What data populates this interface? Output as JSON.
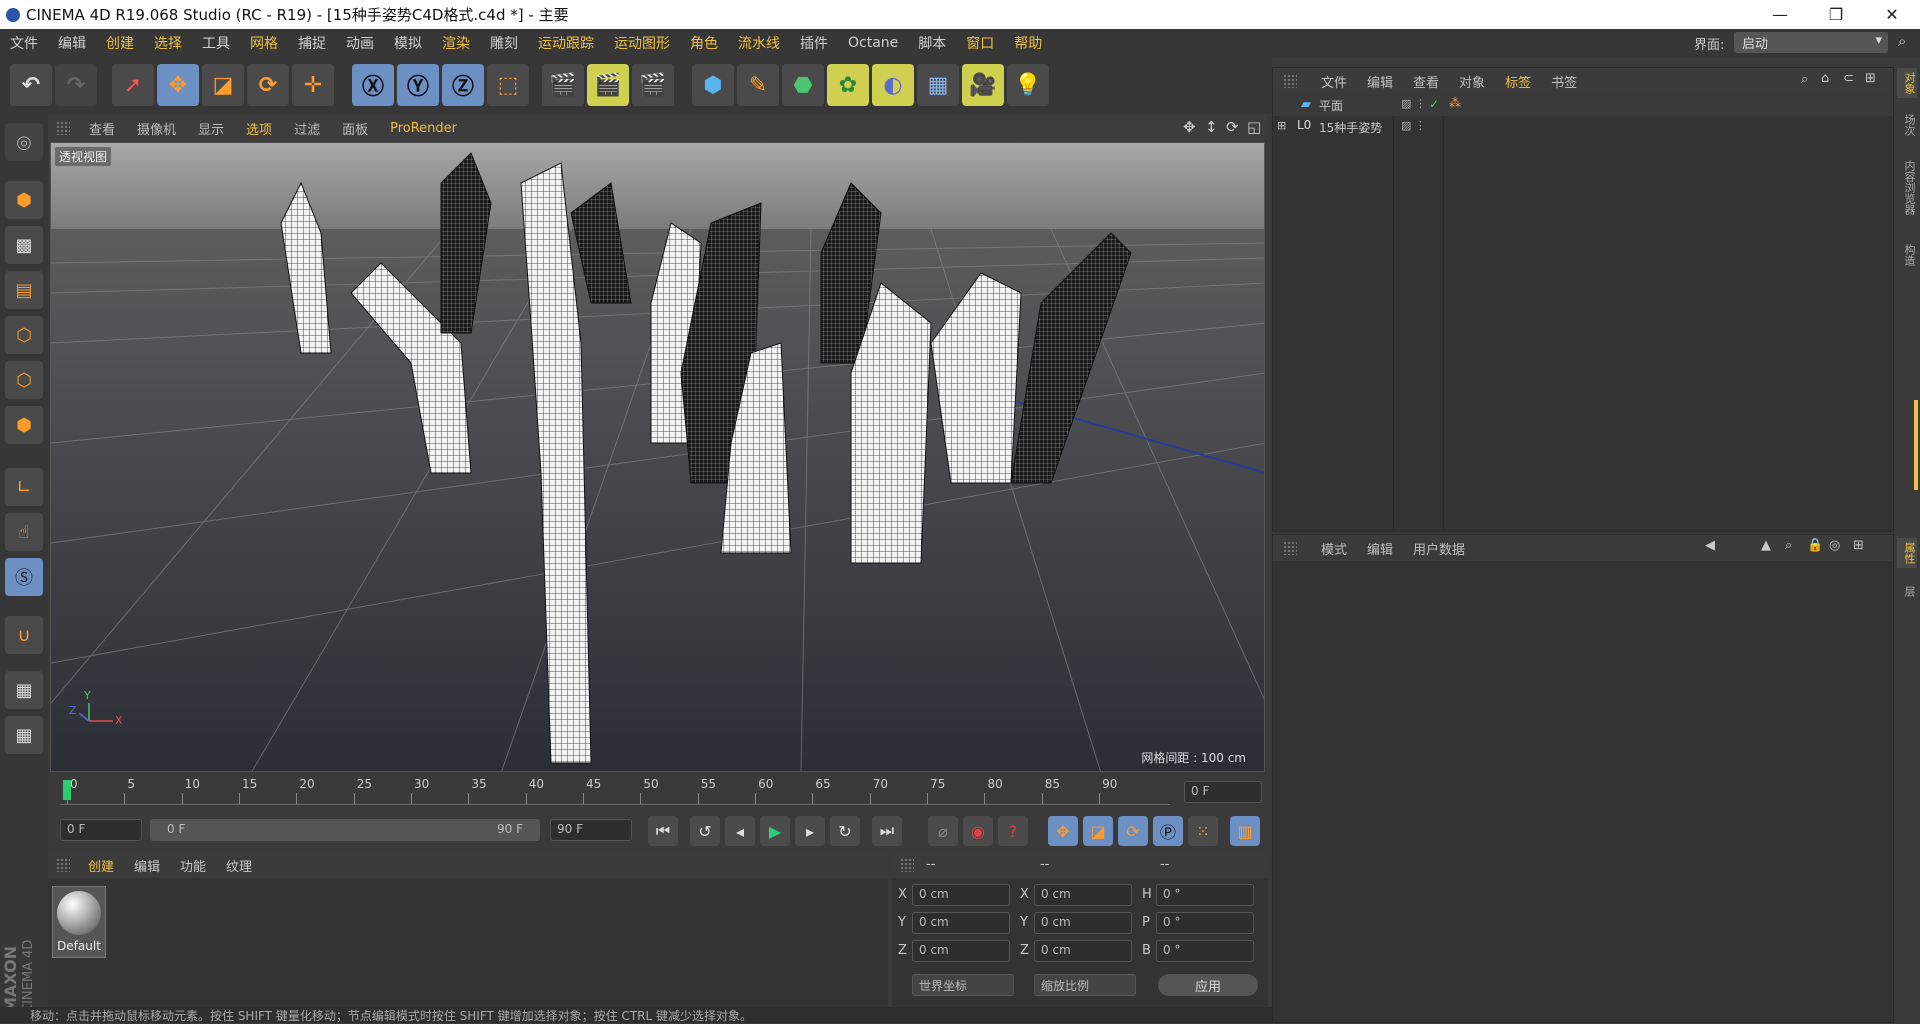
{
  "window": {
    "title": "CINEMA 4D R19.068 Studio (RC - R19) - [15种手姿势C4D格式.c4d *] - 主要"
  },
  "menu": [
    "文件",
    "编辑",
    "创建",
    "选择",
    "工具",
    "网格",
    "捕捉",
    "动画",
    "模拟",
    "渲染",
    "雕刻",
    "运动跟踪",
    "运动图形",
    "角色",
    "流水线",
    "插件",
    "Octane",
    "脚本",
    "窗口",
    "帮助"
  ],
  "layout": {
    "label": "界面:",
    "value": "启动"
  },
  "viewport": {
    "menu": [
      "查看",
      "摄像机",
      "显示",
      "选项",
      "过滤",
      "面板",
      "ProRender"
    ],
    "name": "透视视图",
    "grid_spacing": "网格间距 : 100 cm",
    "axis": {
      "x": "X",
      "y": "Y",
      "z": "Z"
    }
  },
  "timeline": {
    "ticks": [
      "0",
      "5",
      "10",
      "15",
      "20",
      "25",
      "30",
      "35",
      "40",
      "45",
      "50",
      "55",
      "60",
      "65",
      "70",
      "75",
      "80",
      "85",
      "90"
    ],
    "frame_box": "0 F"
  },
  "transport": {
    "start": "0 F",
    "slider_left": "0 F",
    "slider_right": "90 F",
    "end": "90 F"
  },
  "material_panel": {
    "tabs": [
      "创建",
      "编辑",
      "功能",
      "纹理"
    ],
    "material_name": "Default"
  },
  "coord_panel": {
    "headers": [
      "--",
      "--",
      "--"
    ],
    "rows": [
      {
        "a": "X",
        "v1": "0 cm",
        "b": "X",
        "v2": "0 cm",
        "c": "H",
        "v3": "0 °"
      },
      {
        "a": "Y",
        "v1": "0 cm",
        "b": "Y",
        "v2": "0 cm",
        "c": "P",
        "v3": "0 °"
      },
      {
        "a": "Z",
        "v1": "0 cm",
        "b": "Z",
        "v2": "0 cm",
        "c": "B",
        "v3": "0 °"
      }
    ],
    "coord_mode": "世界坐标",
    "scale_mode": "缩放比例",
    "apply": "应用"
  },
  "object_manager": {
    "menu": [
      "文件",
      "编辑",
      "查看",
      "对象",
      "标签",
      "书签"
    ],
    "objects": [
      {
        "name": "平面"
      },
      {
        "name": "15种手姿势"
      }
    ]
  },
  "attribute_manager": {
    "menu": [
      "模式",
      "编辑",
      "用户数据"
    ]
  },
  "right_tabs_top": [
    "对象",
    "场次",
    "内容浏览器",
    "构造"
  ],
  "right_tabs_bottom": [
    "属性",
    "层"
  ],
  "brand": {
    "line1": "MAXON",
    "line2": "CINEMA 4D"
  },
  "status": "移动：点击并拖动鼠标移动元素。按住 SHIFT 键量化移动；节点编辑模式时按住 SHIFT 键增加选择对象；按住 CTRL 键减少选择对象。"
}
